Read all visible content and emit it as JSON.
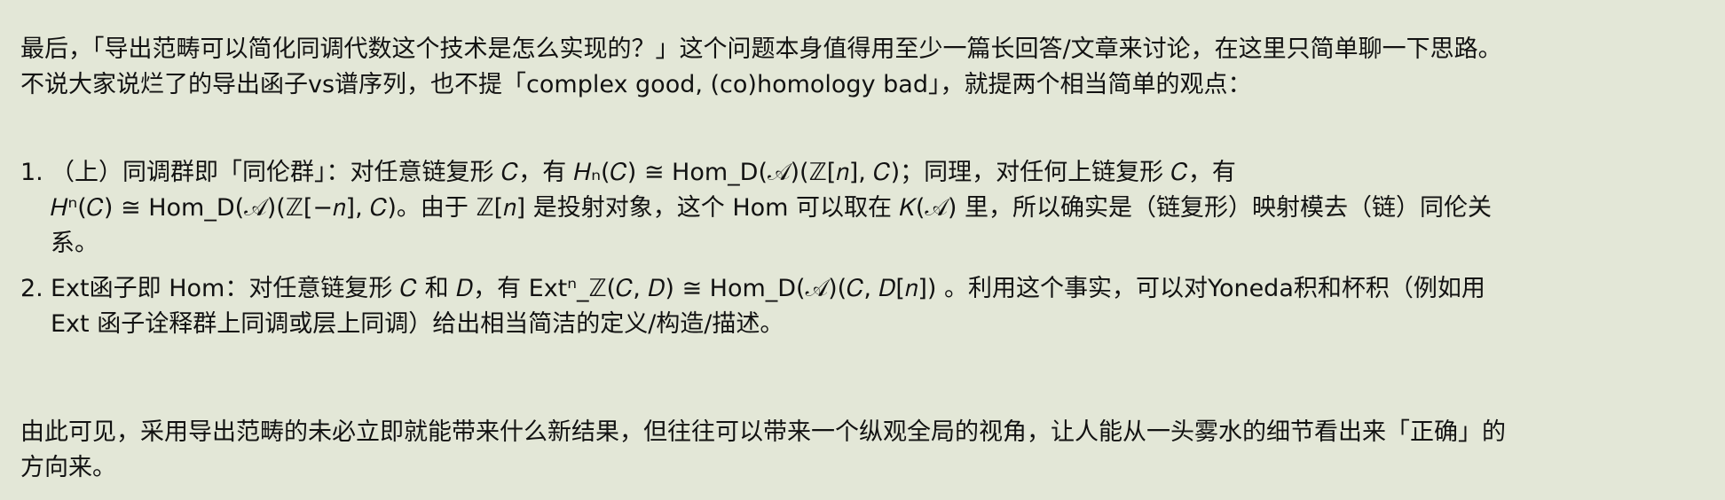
{
  "intro": {
    "line1": "最后，「导出范畴可以简化同调代数这个技术是怎么实现的？」这个问题本身值得用至少一篇长回答/文章来讨论，在这里只简单聊一下思路。",
    "line2": "不说大家说烂了的导出函子vs谱序列，也不提「complex good, (co)homology bad」，就提两个相当简单的观点："
  },
  "points": [
    {
      "number": "1.",
      "lines": [
        "（上）同调群即「同伦群」：对任意链复形 𝐶，有 𝐻ₙ(𝐶) ≅ Hom_D(𝒜)(ℤ[𝑛], 𝐶)；同理，对任何上链复形 𝐶，有",
        "𝐻ⁿ(𝐶) ≅ Hom_D(𝒜)(ℤ[−𝑛], 𝐶)。由于 ℤ[𝑛] 是投射对象，这个 Hom 可以取在 𝐾(𝒜) 里，所以确实是（链复形）映射模去（链）同伦关",
        "系。"
      ]
    },
    {
      "number": "2.",
      "lines": [
        "Ext函子即 Hom：对任意链复形 𝐶 和 𝐷，有 Extⁿ_ℤ(𝐶, 𝐷) ≅ Hom_D(𝒜)(𝐶, 𝐷[𝑛]) 。利用这个事实，可以对Yoneda积和杯积（例如用",
        "Ext 函子诠释群上同调或层上同调）给出相当简洁的定义/构造/描述。"
      ]
    }
  ],
  "conclusion": {
    "line1": "由此可见，采用导出范畴的未必立即就能带来什么新结果，但往往可以带来一个纵观全局的视角，让人能从一头雾水的细节看出来「正确」的",
    "line2": "方向来。"
  }
}
